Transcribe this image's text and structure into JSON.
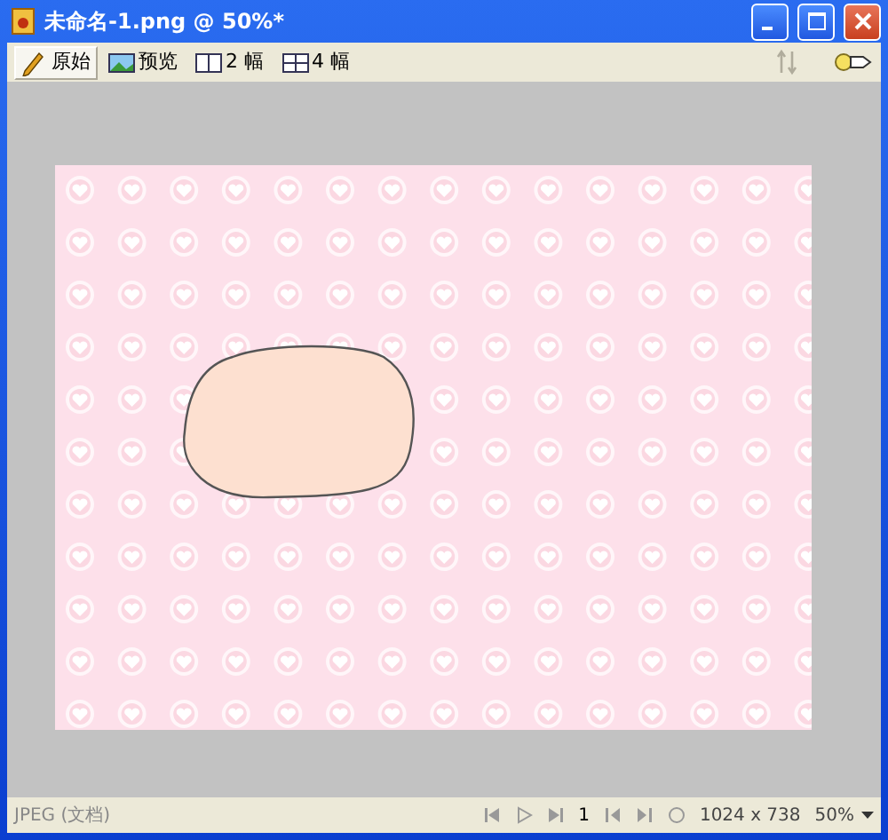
{
  "window": {
    "title": "未命名-1.png @ 50%*"
  },
  "view_tabs": [
    {
      "label": "原始",
      "kind": "pencil",
      "selected": true
    },
    {
      "label": "预览",
      "kind": "image",
      "selected": false
    },
    {
      "label": "2 幅",
      "kind": "two",
      "selected": false
    },
    {
      "label": "4 幅",
      "kind": "four",
      "selected": false
    }
  ],
  "status_bar": {
    "file_type": "JPEG (文档)",
    "frame": "1",
    "dimensions": "1024 x 738",
    "zoom": "50%"
  }
}
